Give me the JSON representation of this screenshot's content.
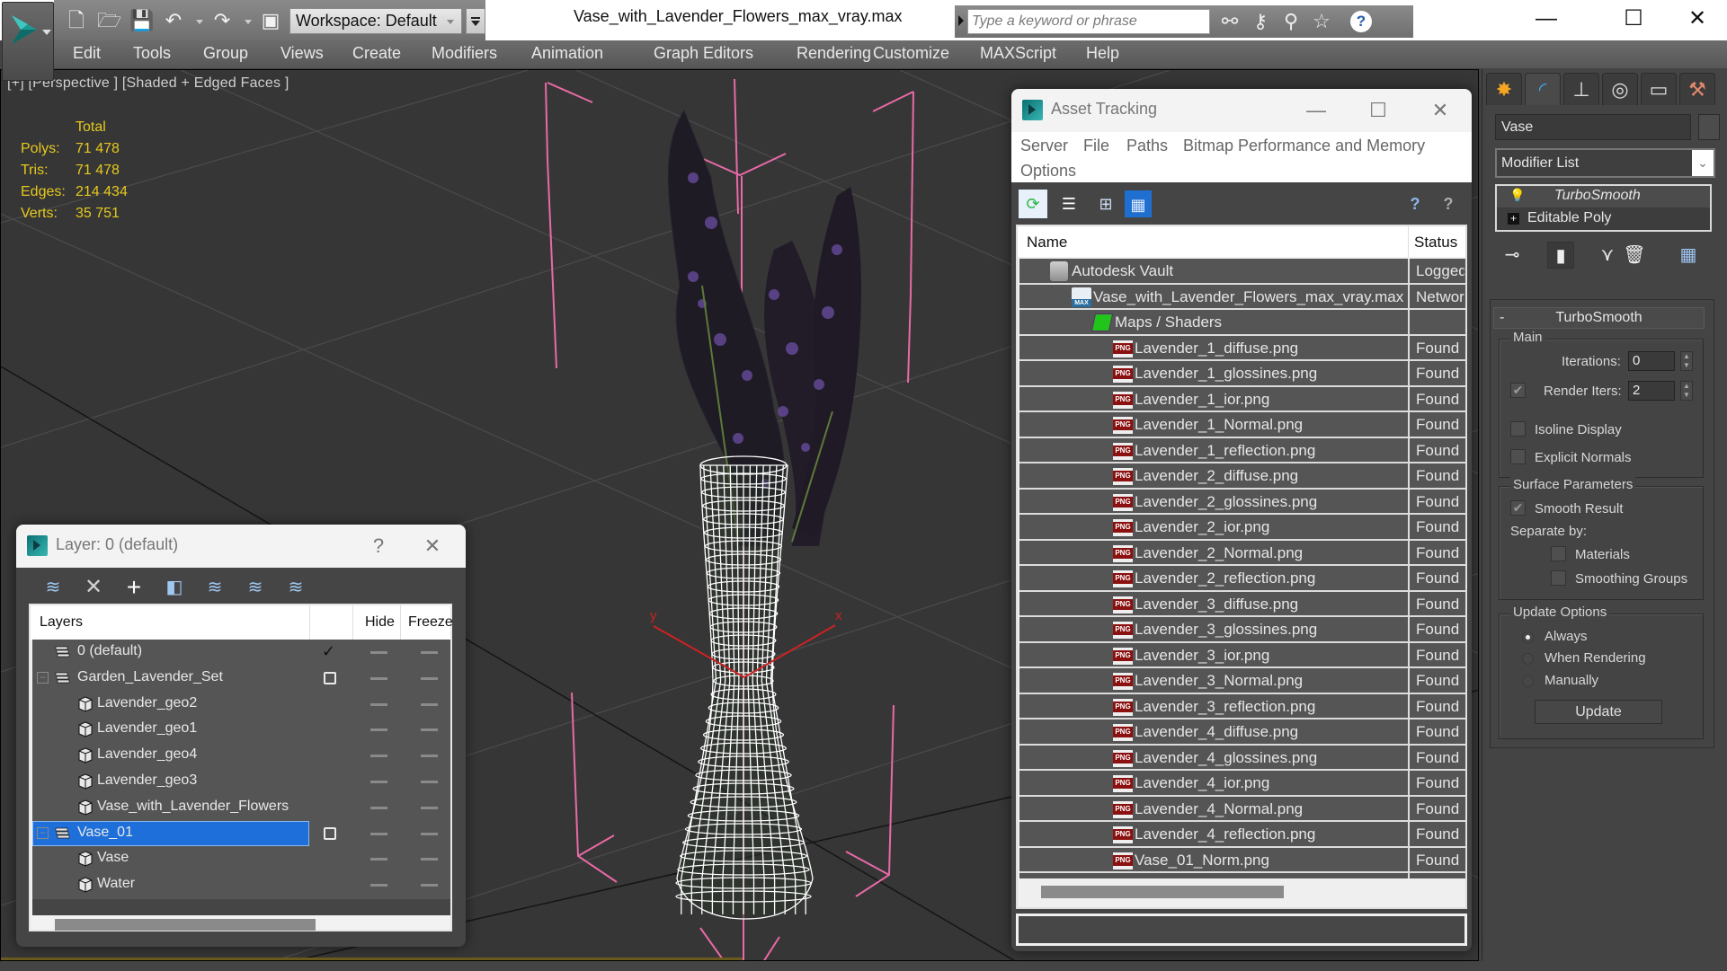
{
  "app": {
    "window_title": "Vase_with_Lavender_Flowers_max_vray.max",
    "workspace": "Workspace: Default",
    "search_placeholder": "Type a keyword or phrase",
    "window_controls": {
      "minimize": "—",
      "maximize": "☐",
      "close": "✕"
    }
  },
  "quick_access": [
    {
      "name": "new-file-icon",
      "glyph": "🗋"
    },
    {
      "name": "open-file-icon",
      "glyph": "🗁"
    },
    {
      "name": "save-icon",
      "glyph": "💾"
    },
    {
      "name": "undo-icon",
      "glyph": "↶"
    },
    {
      "name": "redo-icon",
      "glyph": "↷"
    },
    {
      "name": "project-icon",
      "glyph": "▣"
    }
  ],
  "search_tools": [
    {
      "name": "binoculars-icon",
      "glyph": "⚯"
    },
    {
      "name": "key-icon",
      "glyph": "⚷"
    },
    {
      "name": "satellite-icon",
      "glyph": "⚲"
    },
    {
      "name": "star-icon",
      "glyph": "☆"
    },
    {
      "name": "help-icon",
      "glyph": "?"
    }
  ],
  "menu": [
    "Edit",
    "Tools",
    "Group",
    "Views",
    "Create",
    "Modifiers",
    "Animation",
    "Graph Editors",
    "Rendering",
    "Customize",
    "MAXScript",
    "Help"
  ],
  "viewport": {
    "label": "[+] [Perspective ] [Shaded + Edged Faces ]",
    "stats": {
      "header": "Total",
      "rows": [
        {
          "key": "Polys:",
          "value": "71 478"
        },
        {
          "key": "Tris:",
          "value": "71 478"
        },
        {
          "key": "Edges:",
          "value": "214 434"
        },
        {
          "key": "Verts:",
          "value": "35 751"
        }
      ]
    },
    "gizmo": {
      "x_label": "x",
      "y_label": "y"
    }
  },
  "command_panel": {
    "tabs": [
      {
        "name": "create-tab",
        "glyph": "✸",
        "color": "#f5a623"
      },
      {
        "name": "modify-tab",
        "glyph": "◜",
        "color": "#3fa4e8",
        "active": true
      },
      {
        "name": "hierarchy-tab",
        "glyph": "⊥",
        "color": "#dddddd"
      },
      {
        "name": "motion-tab",
        "glyph": "◎",
        "color": "#dddddd"
      },
      {
        "name": "display-tab",
        "glyph": "▭",
        "color": "#dddddd"
      },
      {
        "name": "utilities-tab",
        "glyph": "⚒",
        "color": "#e0876a"
      }
    ],
    "object_name": "Vase",
    "modifier_list": "Modifier List",
    "modifier_stack": [
      {
        "label": "TurboSmooth",
        "italic": true
      },
      {
        "label": "Editable Poly",
        "italic": false
      }
    ],
    "stack_tools": [
      {
        "name": "pin-stack-icon",
        "glyph": "⊸"
      },
      {
        "name": "show-end-result-icon",
        "glyph": "▮"
      },
      {
        "name": "make-unique-icon",
        "glyph": "⋎"
      },
      {
        "name": "remove-modifier-icon",
        "glyph": "🗑"
      },
      {
        "name": "configure-modifier-sets-icon",
        "glyph": "▦"
      }
    ],
    "turbosmooth": {
      "title": "TurboSmooth",
      "collapse": "-",
      "main_group": "Main",
      "iterations_label": "Iterations:",
      "iterations": "0",
      "render_iters_label": "Render Iters:",
      "render_iters": "2",
      "render_iters_checked": true,
      "isoline_display": "Isoline Display",
      "isoline_checked": false,
      "explicit_normals": "Explicit Normals",
      "explicit_checked": false,
      "surface_group": "Surface Parameters",
      "smooth_result": "Smooth Result",
      "smooth_result_checked": true,
      "separate_by": "Separate by:",
      "materials": "Materials",
      "smoothing_groups": "Smoothing Groups",
      "update_group": "Update Options",
      "update_options": [
        "Always",
        "When Rendering",
        "Manually"
      ],
      "update_selected": "Always",
      "update_button": "Update"
    }
  },
  "layer_dialog": {
    "title": "Layer: 0 (default)",
    "help": "?",
    "close": "✕",
    "toolbar": [
      {
        "name": "create-layer-icon",
        "glyph": "≋"
      },
      {
        "name": "delete-layer-icon",
        "glyph": "✕"
      },
      {
        "name": "add-to-layer-icon",
        "glyph": "+"
      },
      {
        "name": "select-objects-icon",
        "glyph": "◧"
      },
      {
        "name": "select-layer-icon",
        "glyph": "≋"
      },
      {
        "name": "highlight-layer-icon",
        "glyph": "≋"
      },
      {
        "name": "hide-all-layers-icon",
        "glyph": "≋"
      }
    ],
    "columns": {
      "layers": "Layers",
      "hide": "Hide",
      "freeze": "Freeze"
    },
    "rows": [
      {
        "label": "0 (default)",
        "type": "layer",
        "level": 0,
        "current": true,
        "expander": false
      },
      {
        "label": "Garden_Lavender_Set",
        "type": "layer",
        "level": 0,
        "current": false,
        "expander": true
      },
      {
        "label": "Lavender_geo2",
        "type": "object",
        "level": 1
      },
      {
        "label": "Lavender_geo1",
        "type": "object",
        "level": 1
      },
      {
        "label": "Lavender_geo4",
        "type": "object",
        "level": 1
      },
      {
        "label": "Lavender_geo3",
        "type": "object",
        "level": 1
      },
      {
        "label": "Vase_with_Lavender_Flowers",
        "type": "object",
        "level": 1
      },
      {
        "label": "Vase_01",
        "type": "layer",
        "level": 0,
        "current": false,
        "expander": true,
        "selected": true
      },
      {
        "label": "Vase",
        "type": "object",
        "level": 1
      },
      {
        "label": "Water",
        "type": "object",
        "level": 1
      }
    ]
  },
  "asset_dialog": {
    "title": "Asset Tracking",
    "controls": {
      "minimize": "—",
      "maximize": "☐",
      "close": "✕"
    },
    "menu": [
      "Server",
      "File",
      "Paths",
      "Bitmap Performance and Memory",
      "Options"
    ],
    "toolbar": [
      {
        "name": "refresh-icon",
        "glyph": "⟳",
        "active": false
      },
      {
        "name": "list-view-icon",
        "glyph": "☰",
        "active": false
      },
      {
        "name": "tree-view-icon",
        "glyph": "⊞",
        "active": false
      },
      {
        "name": "table-view-icon",
        "glyph": "▦",
        "active": true
      },
      {
        "name": "online-help-icon",
        "glyph": "?",
        "active": false
      },
      {
        "name": "help-icon",
        "glyph": "?",
        "active": false
      }
    ],
    "columns": {
      "name": "Name",
      "status": "Status"
    },
    "rows": [
      {
        "name": "Autodesk Vault",
        "status": "Logged",
        "icon": "vault",
        "level": 0
      },
      {
        "name": "Vase_with_Lavender_Flowers_max_vray.max",
        "status": "Network",
        "icon": "max",
        "level": 1
      },
      {
        "name": "Maps / Shaders",
        "status": "",
        "icon": "maps",
        "level": 2
      },
      {
        "name": "Lavender_1_diffuse.png",
        "status": "Found",
        "icon": "png",
        "level": 3
      },
      {
        "name": "Lavender_1_glossines.png",
        "status": "Found",
        "icon": "png",
        "level": 3
      },
      {
        "name": "Lavender_1_ior.png",
        "status": "Found",
        "icon": "png",
        "level": 3
      },
      {
        "name": "Lavender_1_Normal.png",
        "status": "Found",
        "icon": "png",
        "level": 3
      },
      {
        "name": "Lavender_1_reflection.png",
        "status": "Found",
        "icon": "png",
        "level": 3
      },
      {
        "name": "Lavender_2_diffuse.png",
        "status": "Found",
        "icon": "png",
        "level": 3
      },
      {
        "name": "Lavender_2_glossines.png",
        "status": "Found",
        "icon": "png",
        "level": 3
      },
      {
        "name": "Lavender_2_ior.png",
        "status": "Found",
        "icon": "png",
        "level": 3
      },
      {
        "name": "Lavender_2_Normal.png",
        "status": "Found",
        "icon": "png",
        "level": 3
      },
      {
        "name": "Lavender_2_reflection.png",
        "status": "Found",
        "icon": "png",
        "level": 3
      },
      {
        "name": "Lavender_3_diffuse.png",
        "status": "Found",
        "icon": "png",
        "level": 3
      },
      {
        "name": "Lavender_3_glossines.png",
        "status": "Found",
        "icon": "png",
        "level": 3
      },
      {
        "name": "Lavender_3_ior.png",
        "status": "Found",
        "icon": "png",
        "level": 3
      },
      {
        "name": "Lavender_3_Normal.png",
        "status": "Found",
        "icon": "png",
        "level": 3
      },
      {
        "name": "Lavender_3_reflection.png",
        "status": "Found",
        "icon": "png",
        "level": 3
      },
      {
        "name": "Lavender_4_diffuse.png",
        "status": "Found",
        "icon": "png",
        "level": 3
      },
      {
        "name": "Lavender_4_glossines.png",
        "status": "Found",
        "icon": "png",
        "level": 3
      },
      {
        "name": "Lavender_4_ior.png",
        "status": "Found",
        "icon": "png",
        "level": 3
      },
      {
        "name": "Lavender_4_Normal.png",
        "status": "Found",
        "icon": "png",
        "level": 3
      },
      {
        "name": "Lavender_4_reflection.png",
        "status": "Found",
        "icon": "png",
        "level": 3
      },
      {
        "name": "Vase_01_Norm.png",
        "status": "Found",
        "icon": "png",
        "level": 3
      }
    ],
    "path_field": ""
  },
  "colors": {
    "stats_yellow": "#e6c81e",
    "selection_blue": "#1e6fd9",
    "bbox_pink": "#e86aa6",
    "gizmo_red": "#cc2222",
    "wire_white": "#ffffff",
    "flower_purple": "#5a3d8a"
  }
}
